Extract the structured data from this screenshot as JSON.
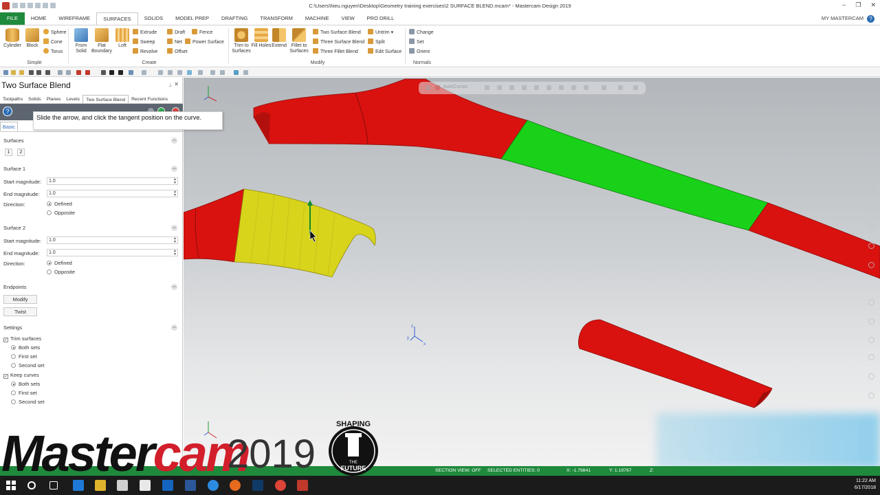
{
  "window": {
    "title": "C:\\Users\\hieu.nguyen\\Desktop\\Geometry training exercises\\2 SURFACE BLEND.mcam* - Mastercam Design 2019",
    "controls": [
      "–",
      "❐",
      "✕"
    ]
  },
  "ribbon_tabs": [
    "FILE",
    "HOME",
    "WIREFRAME",
    "SURFACES",
    "SOLIDS",
    "MODEL PREP",
    "DRAFTING",
    "TRANSFORM",
    "MACHINE",
    "VIEW",
    "PRO DRILL"
  ],
  "active_tab": "SURFACES",
  "my_mastercam": "MY MASTERCAM",
  "ribbon": {
    "simple": {
      "label": "Simple",
      "big": [
        "Cylinder",
        "Block"
      ],
      "small": [
        "Sphere",
        "Cone",
        "Torus"
      ]
    },
    "create": {
      "label": "Create",
      "big": [
        "From Solid",
        "Flat Boundary",
        "Loft"
      ],
      "small": [
        "Extrude",
        "Sweep",
        "Revolve",
        "Draft",
        "Net",
        "Offset",
        "Fence",
        "Power Surface"
      ]
    },
    "modify": {
      "label": "Modify",
      "big": [
        "Trim to Surfaces",
        "Fill Holes",
        "Extend",
        "Fillet to Surfaces"
      ],
      "small": [
        "Two Surface Blend",
        "Three Surface Blend",
        "Three Fillet Blend",
        "Untrim",
        "Split",
        "Edit Surface"
      ]
    },
    "normals": {
      "label": "Normals",
      "small": [
        "Change",
        "Set",
        "Orient"
      ]
    }
  },
  "panel": {
    "title": "Two Surface Blend",
    "manager_tabs": [
      "Toolpaths",
      "Solids",
      "Planes",
      "Levels",
      "Two Surface Blend",
      "Recent Functions"
    ],
    "active_manager_tab": "Two Surface Blend",
    "basic_tab": "Basic",
    "surfaces": {
      "heading": "Surfaces",
      "buttons": [
        "1",
        "2"
      ]
    },
    "surface1": {
      "heading": "Surface 1",
      "start_label": "Start magnitude:",
      "start_value": "1.0",
      "end_label": "End magnitude:",
      "end_value": "1.0",
      "direction_label": "Direction:",
      "defined": "Defined",
      "opposite": "Opposite"
    },
    "surface2": {
      "heading": "Surface 2",
      "start_label": "Start magnitude:",
      "start_value": "1.0",
      "end_label": "End magnitude:",
      "end_value": "1.0",
      "direction_label": "Direction:",
      "defined": "Defined",
      "opposite": "Opposite"
    },
    "endpoints": {
      "heading": "Endpoints",
      "modify": "Modify",
      "twist": "Twist"
    },
    "settings": {
      "heading": "Settings",
      "trim": "Trim surfaces",
      "trim_options": [
        "Both sets",
        "First set",
        "Second set"
      ],
      "keep": "Keep curves",
      "keep_options": [
        "Both sets",
        "First set",
        "Second set"
      ]
    }
  },
  "tooltip": "Slide the arrow, and click the tangent position on the curve.",
  "viewport": {
    "autocursor": "AutoCursor",
    "axis_labels": {
      "x": "x",
      "y": "y",
      "z": "z"
    }
  },
  "status": {
    "section_view": "SECTION VIEW: OFF",
    "selected": "SELECTED ENTITIES: 0",
    "x": "X:   -1.79841",
    "y": "Y:   1.19767",
    "z": "Z:"
  },
  "taskbar": {
    "time": "11:22 AM",
    "date": "6/17/2018"
  },
  "watermark": {
    "brand_black": "Master",
    "brand_red": "cam",
    "year": "2019",
    "badge_top": "SHAPING",
    "badge_bottom": "FUTURE",
    "badge_mid": "THE"
  },
  "colors": {
    "brand_green": "#1f8a3c",
    "surface_red": "#d9120f",
    "surface_green": "#19d119",
    "surface_yellow": "#d8d31b",
    "accent_blue": "#2d6db5"
  }
}
